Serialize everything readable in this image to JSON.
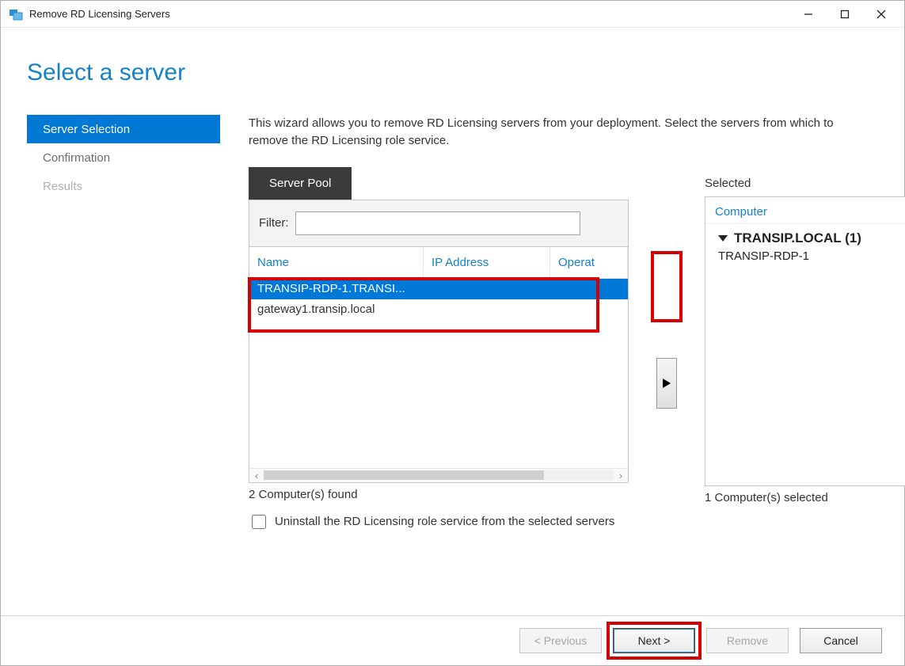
{
  "window": {
    "title": "Remove RD Licensing Servers"
  },
  "header": {
    "title": "Select a server"
  },
  "steps": [
    {
      "label": "Server Selection",
      "state": "active"
    },
    {
      "label": "Confirmation",
      "state": "normal"
    },
    {
      "label": "Results",
      "state": "disabled"
    }
  ],
  "intro": "This wizard allows you to remove RD Licensing servers from your deployment. Select the servers from which to remove the RD Licensing role service.",
  "server_pool": {
    "tab_label": "Server Pool",
    "filter_label": "Filter:",
    "filter_value": "",
    "columns": {
      "name": "Name",
      "ip": "IP Address",
      "os": "Operat"
    },
    "rows": [
      {
        "name": "TRANSIP-RDP-1.TRANSI...",
        "selected": true
      },
      {
        "name": "gateway1.transip.local",
        "selected": false
      }
    ],
    "found_text": "2 Computer(s) found"
  },
  "selected": {
    "section_label": "Selected",
    "column_label": "Computer",
    "group_label": "TRANSIP.LOCAL (1)",
    "items": [
      "TRANSIP-RDP-1"
    ],
    "count_text": "1 Computer(s) selected"
  },
  "uninstall_checkbox": {
    "label": "Uninstall the RD Licensing role service from the selected servers",
    "checked": false
  },
  "footer": {
    "previous": "< Previous",
    "next": "Next >",
    "remove": "Remove",
    "cancel": "Cancel"
  }
}
